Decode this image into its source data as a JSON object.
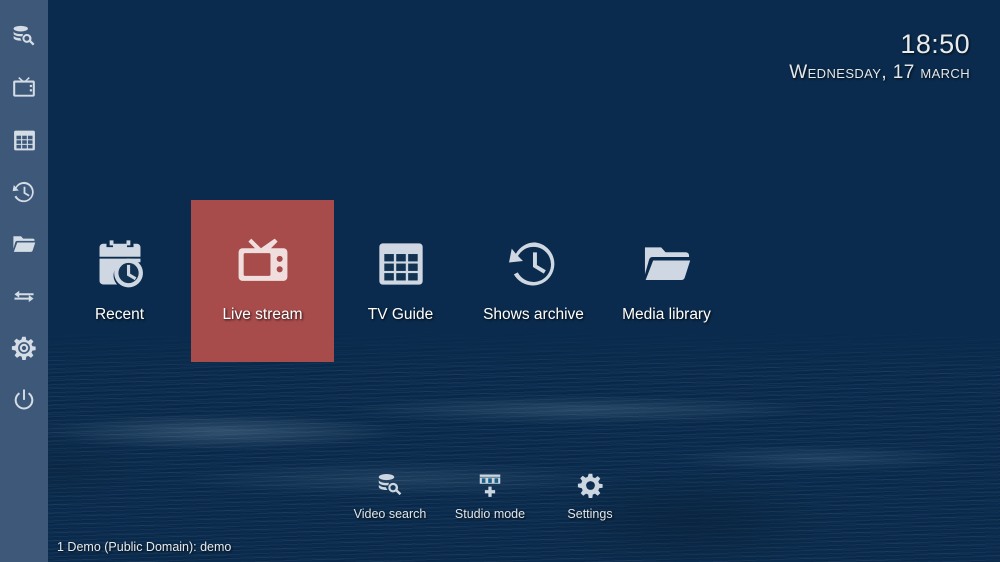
{
  "clock": {
    "time": "18:50",
    "date": "Wednesday, 17 March"
  },
  "sidebar": {
    "items": [
      {
        "label": "Video search",
        "icon": "database-search-icon"
      },
      {
        "label": "Live TV",
        "icon": "television-icon"
      },
      {
        "label": "TV Guide",
        "icon": "grid-table-icon"
      },
      {
        "label": "Shows archive",
        "icon": "history-clock-icon"
      },
      {
        "label": "Media library",
        "icon": "folder-open-icon"
      },
      {
        "label": "Switch",
        "icon": "swap-arrows-icon"
      },
      {
        "label": "Settings",
        "icon": "gear-icon"
      },
      {
        "label": "Power",
        "icon": "power-icon"
      }
    ]
  },
  "main_menu": {
    "focused_index": 1,
    "items": [
      {
        "label": "Recent",
        "icon": "calendar-clock-icon",
        "focused": false
      },
      {
        "label": "Live stream",
        "icon": "retro-tv-icon",
        "focused": true
      },
      {
        "label": "TV Guide",
        "icon": "grid-table-icon",
        "focused": false
      },
      {
        "label": "Shows archive",
        "icon": "history-clock-icon",
        "focused": false
      },
      {
        "label": "Media library",
        "icon": "folder-open-icon",
        "focused": false
      }
    ]
  },
  "sub_menu": {
    "items": [
      {
        "label": "Video search",
        "icon": "database-search-icon"
      },
      {
        "label": "Studio mode",
        "icon": "film-strip-plus-icon"
      },
      {
        "label": "Settings",
        "icon": "gear-icon"
      }
    ]
  },
  "status_bar": {
    "text": "1 Demo (Public Domain): demo"
  },
  "colors": {
    "sidebar_bg": "#3d5878",
    "focus_tile": "#a84b4b",
    "icon_fill": "#cfd8e2",
    "background_top": "#0c3055",
    "background_bottom": "#1a6a90",
    "text": "#ffffff"
  }
}
